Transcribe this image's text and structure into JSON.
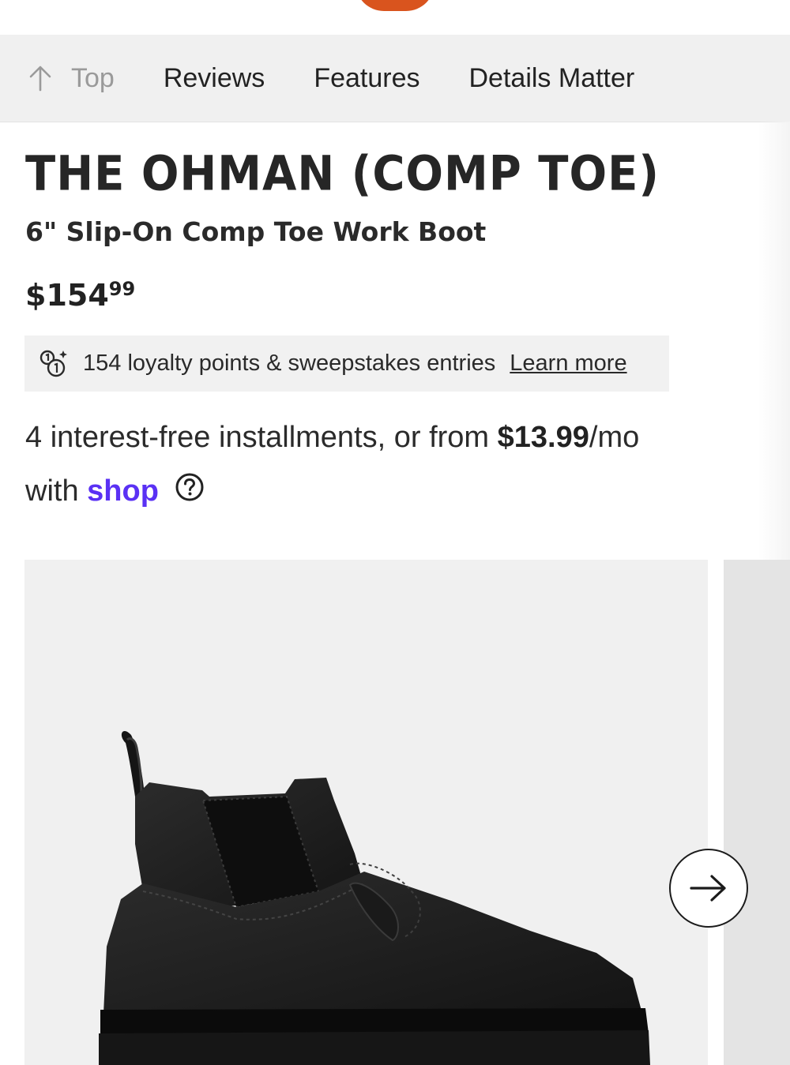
{
  "section_nav": {
    "items": [
      "Top",
      "Reviews",
      "Features",
      "Details Matter"
    ]
  },
  "product": {
    "title": "THE OHMAN (COMP TOE)",
    "subtitle": "6\" Slip-On Comp Toe Work Boot",
    "price_dollars": "$154",
    "price_cents": "99"
  },
  "loyalty": {
    "text": "154 loyalty points & sweepstakes entries",
    "link": "Learn more",
    "icon": "loyalty-points-icon"
  },
  "installments": {
    "prefix": "4 interest-free installments, or from ",
    "amount": "$13.99",
    "suffix": "/mo",
    "with": "with ",
    "brand": "shop",
    "help_icon": "question-circle-icon"
  },
  "gallery": {
    "image": "black-chelsea-work-boot",
    "next_icon": "arrow-right-icon"
  },
  "colors": {
    "brand_orange": "#d9541e",
    "shop_purple": "#5a31f4",
    "nav_bg": "#f0f0f0"
  }
}
